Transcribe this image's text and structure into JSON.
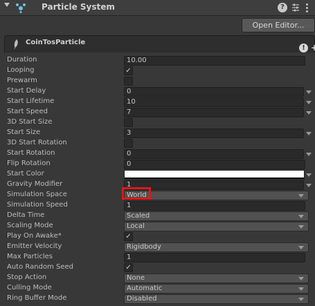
{
  "header": {
    "title": "Particle System"
  },
  "toolbar": {
    "open_editor_label": "Open Editor..."
  },
  "module": {
    "title": "CoinTosParticle"
  },
  "rows": [
    {
      "label": "Duration",
      "type": "text",
      "value": "10.00"
    },
    {
      "label": "Looping",
      "type": "check",
      "checked": true
    },
    {
      "label": "Prewarm",
      "type": "check",
      "checked": false
    },
    {
      "label": "Start Delay",
      "type": "num",
      "value": "0"
    },
    {
      "label": "Start Lifetime",
      "type": "num",
      "value": "10"
    },
    {
      "label": "Start Speed",
      "type": "num",
      "value": "7"
    },
    {
      "label": "3D Start Size",
      "type": "check",
      "checked": false
    },
    {
      "label": "Start Size",
      "type": "num",
      "value": "3"
    },
    {
      "label": "3D Start Rotation",
      "type": "check",
      "checked": false
    },
    {
      "label": "Start Rotation",
      "type": "num",
      "value": "0"
    },
    {
      "label": "Flip Rotation",
      "type": "text",
      "value": "0"
    },
    {
      "label": "Start Color",
      "type": "color",
      "color": "#ffffff"
    },
    {
      "label": "Gravity Modifier",
      "type": "num",
      "value": "1"
    },
    {
      "label": "Simulation Space",
      "type": "dd",
      "value": "World"
    },
    {
      "label": "Simulation Speed",
      "type": "text",
      "value": "1"
    },
    {
      "label": "Delta Time",
      "type": "dd",
      "value": "Scaled"
    },
    {
      "label": "Scaling Mode",
      "type": "dd",
      "value": "Local"
    },
    {
      "label": "Play On Awake*",
      "type": "check",
      "checked": true
    },
    {
      "label": "Emitter Velocity",
      "type": "dd",
      "value": "Rigidbody"
    },
    {
      "label": "Max Particles",
      "type": "text",
      "value": "1"
    },
    {
      "label": "Auto Random Seed",
      "type": "check",
      "checked": true
    },
    {
      "label": "Stop Action",
      "type": "dd",
      "value": "None"
    },
    {
      "label": "Culling Mode",
      "type": "dd",
      "value": "Automatic"
    },
    {
      "label": "Ring Buffer Mode",
      "type": "dd",
      "value": "Disabled"
    }
  ],
  "colors": {
    "highlight": "#e11717",
    "background": "#383838",
    "field": "#2a2a2a"
  }
}
